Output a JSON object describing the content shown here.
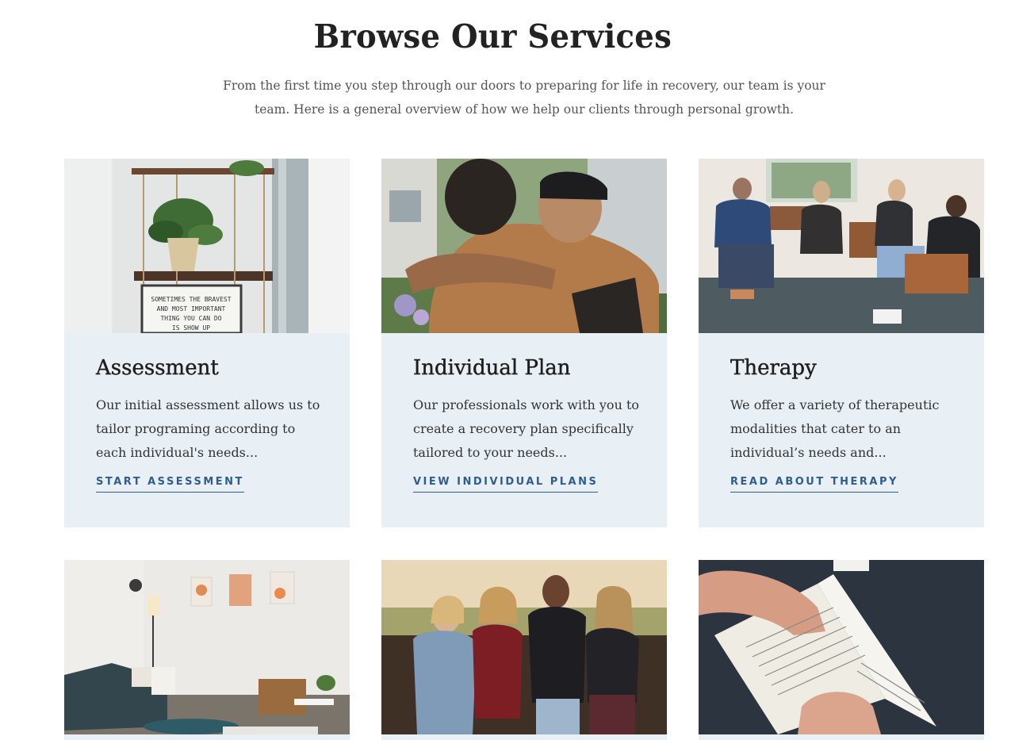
{
  "header": {
    "title": "Browse Our Services",
    "intro": "From the first time you step through our doors to preparing for life in recovery, our team is your team. Here is a general overview of how we help our clients through personal growth."
  },
  "cards": [
    {
      "title": "Assessment",
      "text": "Our initial assessment allows us to tailor programing according to each individual's needs...",
      "link": "START ASSESSMENT"
    },
    {
      "title": "Individual Plan",
      "text": "Our professionals work with you to create a recovery plan specifically tailored to your needs...",
      "link": "VIEW INDIVIDUAL PLANS"
    },
    {
      "title": "Therapy",
      "text": "We offer a variety of therapeutic modalities that cater to an individual’s needs and...",
      "link": "READ ABOUT THERAPY"
    }
  ],
  "photos": [
    {
      "subject": "shelf with plant and letter board",
      "sign_text": [
        "SOMETIMES THE BRAVEST",
        "AND MOST IMPORTANT",
        "THING YOU CAN DO",
        "IS SHOW UP"
      ]
    },
    {
      "subject": "two men hugging outdoors"
    },
    {
      "subject": "group therapy session in chairs"
    },
    {
      "subject": "living room with sofa and wall art"
    },
    {
      "subject": "group of four friends laughing"
    },
    {
      "subject": "hands reading a book"
    }
  ],
  "colors": {
    "card_background": "#e8eff5",
    "link_blue": "#2d5e8f",
    "heading": "#222222",
    "body_text": "#555555"
  }
}
